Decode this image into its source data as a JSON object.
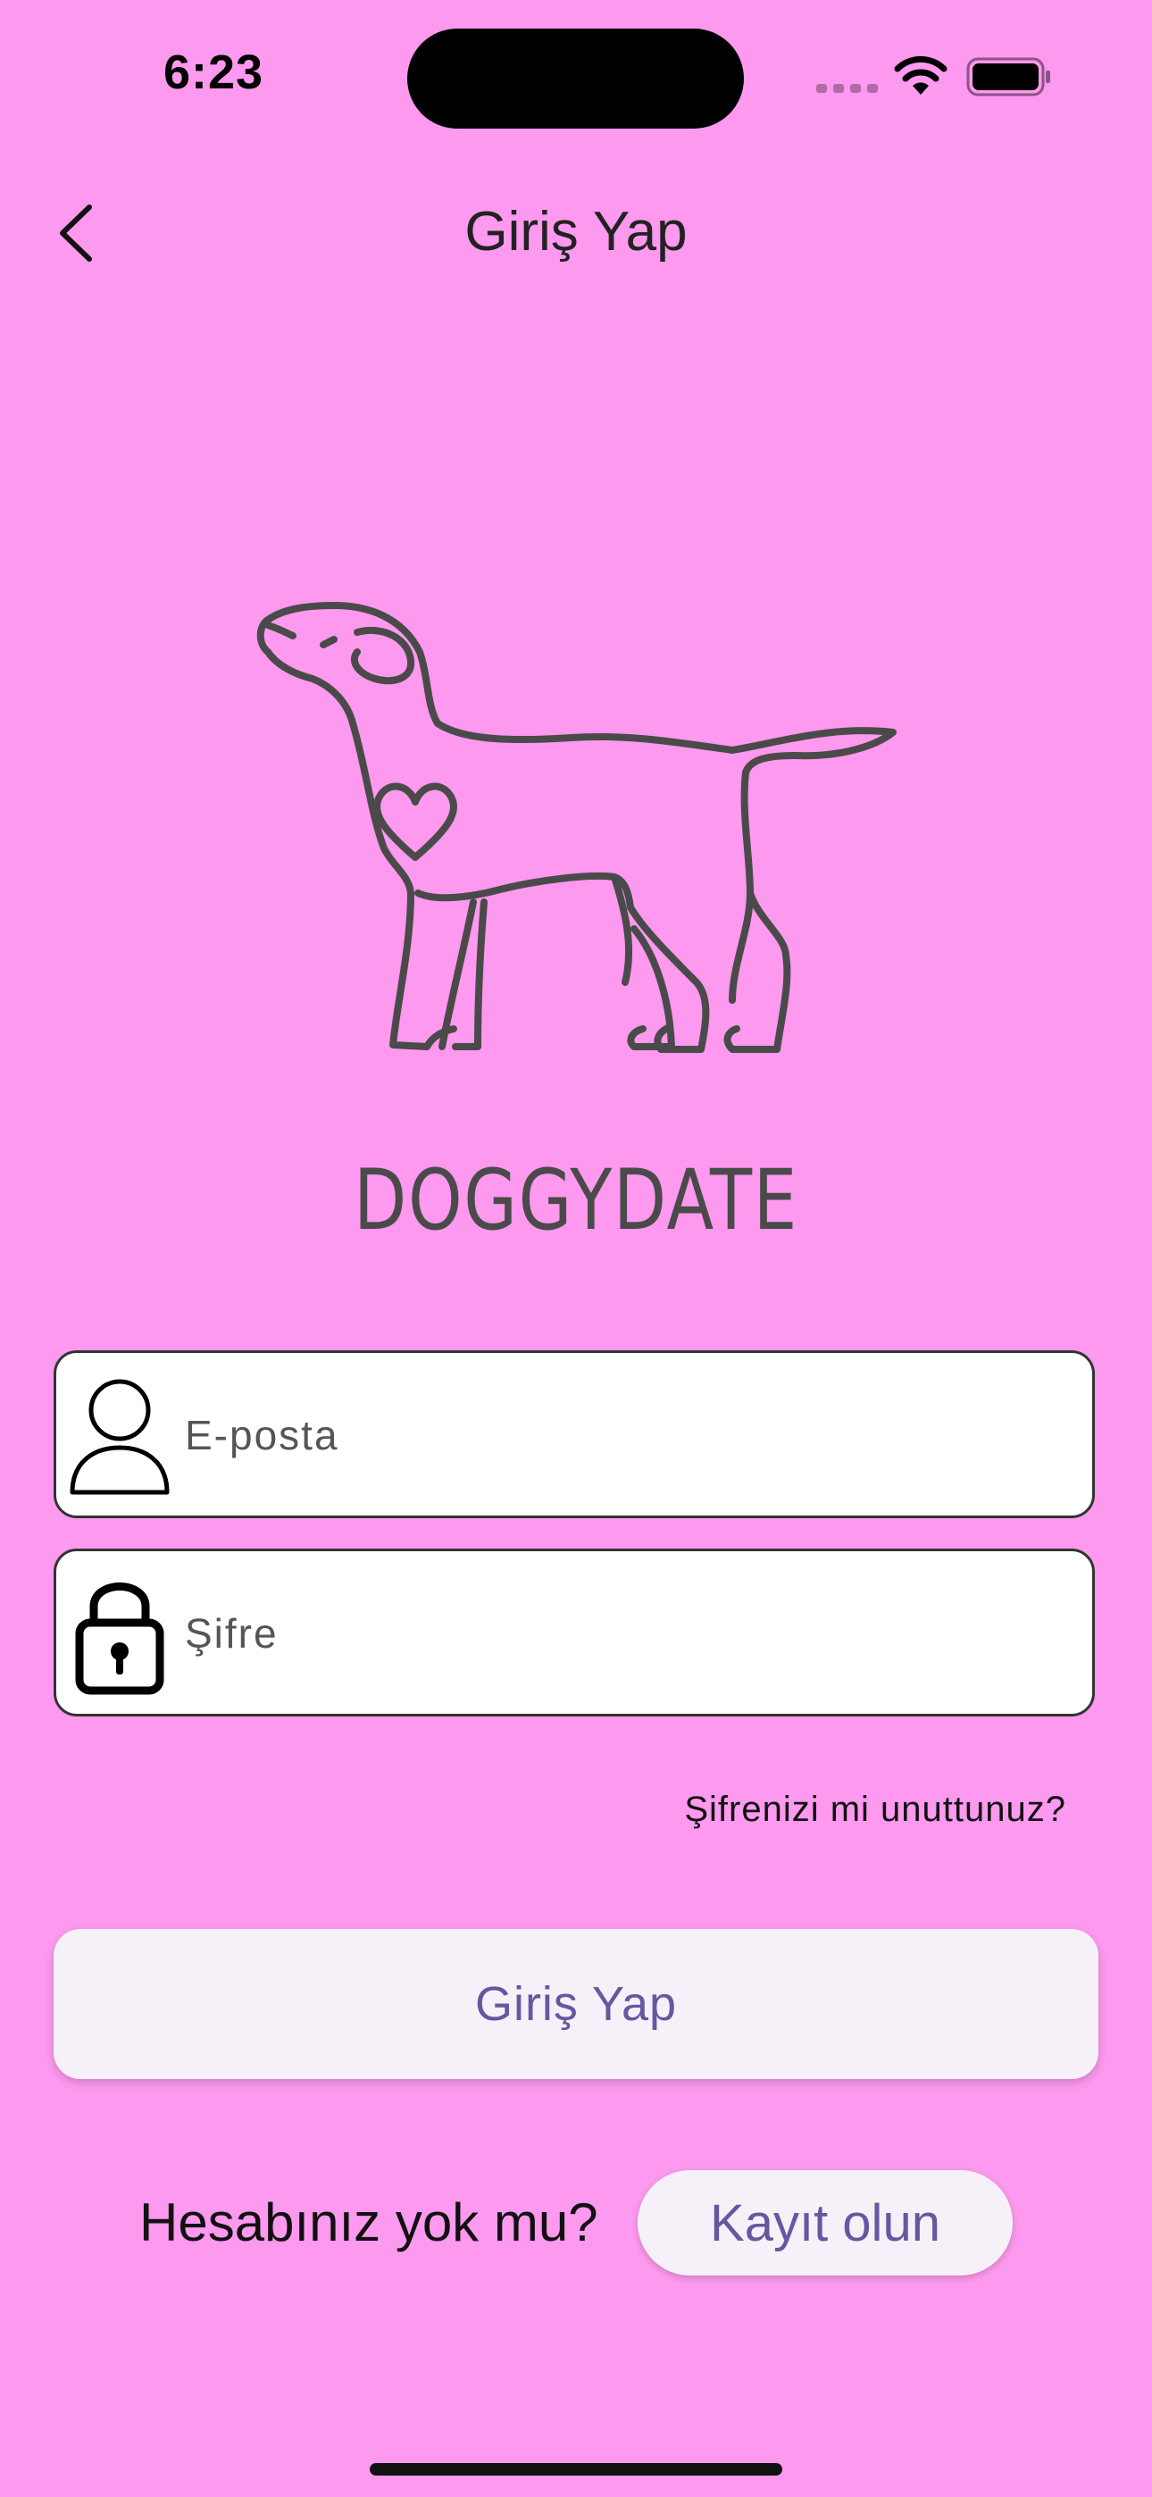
{
  "status_bar": {
    "time": "6:23"
  },
  "nav": {
    "title": "Giriş Yap"
  },
  "logo": {
    "brand_text": "DOGGYDATE"
  },
  "form": {
    "email": {
      "placeholder": "E-posta",
      "value": ""
    },
    "password": {
      "placeholder": "Şifre",
      "value": ""
    },
    "forgot_label": "Şifrenizi mi unuttunuz?",
    "submit_label": "Giriş Yap"
  },
  "signup": {
    "prompt": "Hesabınız yok mu?",
    "button_label": "Kayıt olun"
  },
  "colors": {
    "background": "#FD99EE",
    "button_bg": "#F6F1F8",
    "button_text": "#6A55A0"
  }
}
